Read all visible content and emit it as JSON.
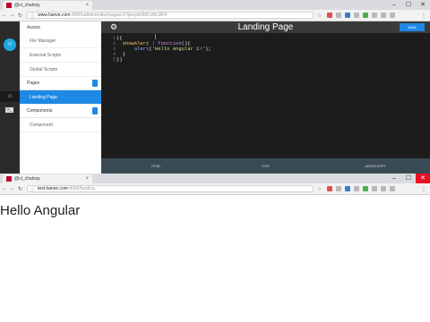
{
  "window1": {
    "tab_title": "@ct_chalosy",
    "url_host": "www.hanve.com",
    "url_path": ":4000/admin/editor/pages/-FSpejzbNMCxfbUAHI",
    "window_controls": [
      "–",
      "☐",
      "✕"
    ]
  },
  "app": {
    "page_title": "Landing Page",
    "save_label": "SAVE",
    "sidebar": {
      "assets_header": "Assets",
      "asset_items": [
        "File Manager",
        "External Scripts",
        "Global Scripts"
      ],
      "pages_header": "Pages",
      "page_items": [
        "Landing Page"
      ],
      "components_header": "Components",
      "component_items": [
        "Component"
      ]
    },
    "code": {
      "line_numbers": [
        "1",
        "2",
        "3",
        "4",
        "5"
      ],
      "line1": "({",
      "line2_prop": "showAlert",
      "line2_kw": "function",
      "line3_fn": "alert",
      "line3_str": "'Hello Angular 2!'",
      "line4": "}",
      "line5": "})"
    },
    "bottom_tabs": [
      "HTML",
      "CSS",
      "JAVASCRIPT"
    ]
  },
  "window2": {
    "tab_title": "@ct_chalosy",
    "url_host": "test.hanve.com",
    "url_path": ":4000/landing",
    "window_controls": [
      "–",
      "☐",
      "✕"
    ],
    "body_text": "Hello Angular"
  },
  "colors": {
    "accent": "#1e88e5",
    "editor_bg": "#1c1c1c",
    "rail": "#2b2b2b",
    "close_red": "#e81123"
  },
  "icons": [
    "back-arrow-icon",
    "forward-arrow-icon",
    "reload-icon",
    "lock-icon",
    "star-icon",
    "menu-icon",
    "gear-icon",
    "home-icon",
    "terminal-icon",
    "document-icon",
    "avatar-icon"
  ]
}
